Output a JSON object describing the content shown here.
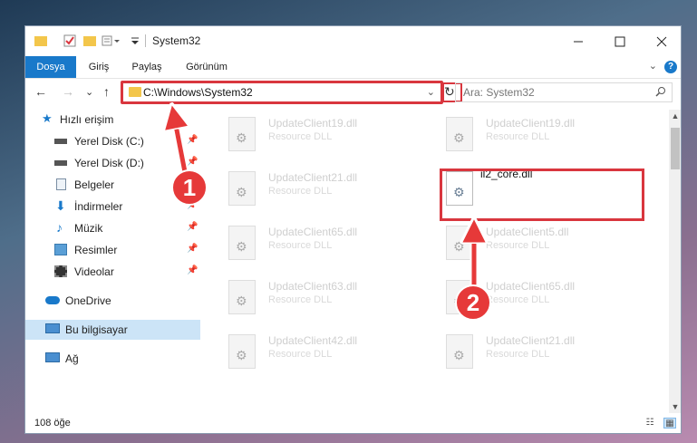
{
  "window": {
    "title": "System32"
  },
  "ribbon": {
    "tabs": [
      {
        "label": "Dosya",
        "active": true
      },
      {
        "label": "Giriş",
        "active": false
      },
      {
        "label": "Paylaş",
        "active": false
      },
      {
        "label": "Görünüm",
        "active": false
      }
    ],
    "expand": "⌄",
    "help": "?"
  },
  "nav": {
    "back": "←",
    "forward": "→",
    "recent": "⌄",
    "up": "↑",
    "address": "C:\\Windows\\System32",
    "address_drop": "⌄",
    "refresh": "↻",
    "search_placeholder": "Ara: System32"
  },
  "sidebar": {
    "items": [
      {
        "label": "Hızlı erişim",
        "icon": "star-icon",
        "pinned": false
      },
      {
        "label": "Yerel Disk (C:)",
        "icon": "drive-icon",
        "pinned": true
      },
      {
        "label": "Yerel Disk (D:)",
        "icon": "drive-icon",
        "pinned": true
      },
      {
        "label": "Belgeler",
        "icon": "documents-icon",
        "pinned": true
      },
      {
        "label": "İndirmeler",
        "icon": "download-icon",
        "pinned": true
      },
      {
        "label": "Müzik",
        "icon": "music-icon",
        "pinned": true
      },
      {
        "label": "Resimler",
        "icon": "pictures-icon",
        "pinned": true
      },
      {
        "label": "Videolar",
        "icon": "videos-icon",
        "pinned": true
      },
      {
        "label": "OneDrive",
        "icon": "cloud-icon",
        "pinned": false
      },
      {
        "label": "Bu bilgisayar",
        "icon": "computer-icon",
        "pinned": false,
        "selected": true
      },
      {
        "label": "Ağ",
        "icon": "network-icon",
        "pinned": false
      }
    ]
  },
  "files": [
    {
      "name": "UpdateClient19.dll",
      "type": "Resource DLL"
    },
    {
      "name": "UpdateClient19.dll",
      "type": "Resource DLL"
    },
    {
      "name": "UpdateClient21.dll",
      "type": "Resource DLL"
    },
    {
      "name": "il2_core.dll",
      "type": "",
      "featured": true
    },
    {
      "name": "UpdateClient65.dll",
      "type": "Resource DLL"
    },
    {
      "name": "UpdateClient5.dll",
      "type": "Resource DLL"
    },
    {
      "name": "UpdateClient63.dll",
      "type": "Resource DLL"
    },
    {
      "name": "UpdateClient65.dll",
      "type": "Resource DLL"
    },
    {
      "name": "UpdateClient42.dll",
      "type": "Resource DLL"
    },
    {
      "name": "UpdateClient21.dll",
      "type": "Resource DLL"
    }
  ],
  "status": {
    "count": "108 öğe"
  },
  "annotations": {
    "one": "1",
    "two": "2"
  },
  "colors": {
    "accent": "#1979ca",
    "highlight": "#d9363e",
    "callout": "#e63939",
    "folder": "#f3c64b"
  }
}
